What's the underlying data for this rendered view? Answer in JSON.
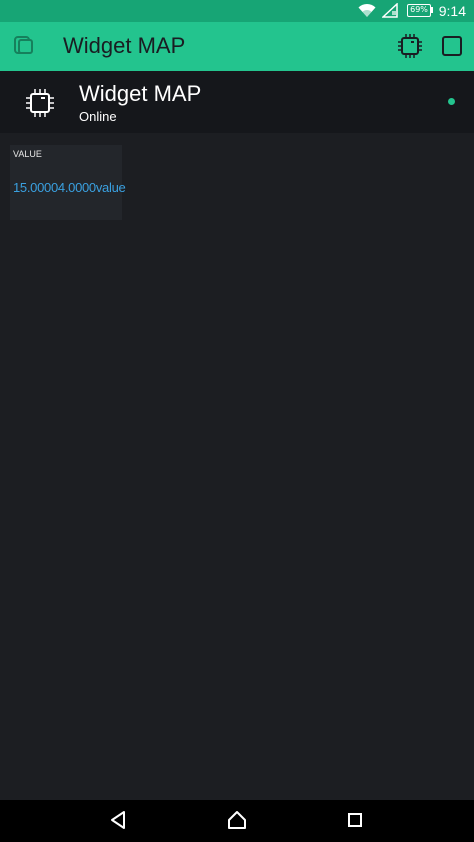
{
  "status_bar": {
    "battery_percent": "69%",
    "time": "9:14",
    "icons": [
      "wifi-icon",
      "signal-icon",
      "battery-icon"
    ]
  },
  "toolbar": {
    "title": "Widget MAP",
    "left_icon": "device-switch-icon",
    "right_icons": [
      "chip-icon",
      "stop-square-icon"
    ]
  },
  "device": {
    "name": "Widget MAP",
    "status": "Online",
    "status_color": "#23c48e",
    "icon": "chip-icon"
  },
  "widget": {
    "label": "VALUE",
    "value": "15.00004.0000value",
    "value_color": "#3aa0e0"
  },
  "nav_bar": {
    "icons": [
      "back-triangle-icon",
      "home-circle-icon",
      "recents-square-icon"
    ]
  },
  "colors": {
    "accent": "#23c48e",
    "status_bar": "#17a575",
    "background": "#1c1e22",
    "header_background": "#15171b"
  }
}
